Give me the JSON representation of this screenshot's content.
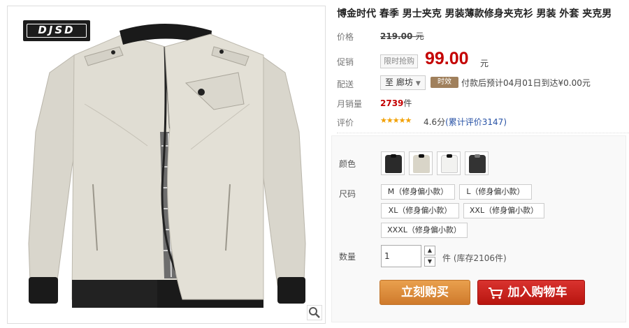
{
  "product": {
    "brand_logo": "DJSD",
    "title": "博金时代 春季 男士夹克 男装薄款修身夹克衫 男装 外套 夹克男"
  },
  "price": {
    "label": "价格",
    "original": "219.00",
    "currency": "元"
  },
  "promo": {
    "label": "促销",
    "tag": "限时抢购",
    "price": "99.00",
    "currency": "元"
  },
  "shipping": {
    "label": "配送",
    "destination": "至 廊坊",
    "badge": "时效",
    "text": "付款后预计04月01日到达¥0.00元"
  },
  "sales": {
    "label": "月销量",
    "count": "2739",
    "unit": "件"
  },
  "rating": {
    "label": "评价",
    "stars": "★★★★★",
    "score": "4.6分",
    "reviews_link": "(累计评价3147)",
    "star_color": "#f2a000"
  },
  "options": {
    "color_label": "颜色",
    "colors": [
      "black",
      "beige",
      "white",
      "black-gray"
    ],
    "size_label": "尺码",
    "sizes": [
      "M（修身偏小款）",
      "L（修身偏小款）",
      "XL（修身偏小款）",
      "XXL（修身偏小款）",
      "XXXL（修身偏小款）"
    ],
    "quantity_label": "数量",
    "quantity": "1",
    "stock": "件 (库存2106件)"
  },
  "actions": {
    "buy_now": "立刻购买",
    "add_to_cart": "加入购物车"
  },
  "colors": {
    "accent_red": "#c40000",
    "buy_orange": "#cf7a2c",
    "cart_red": "#b8150f"
  }
}
